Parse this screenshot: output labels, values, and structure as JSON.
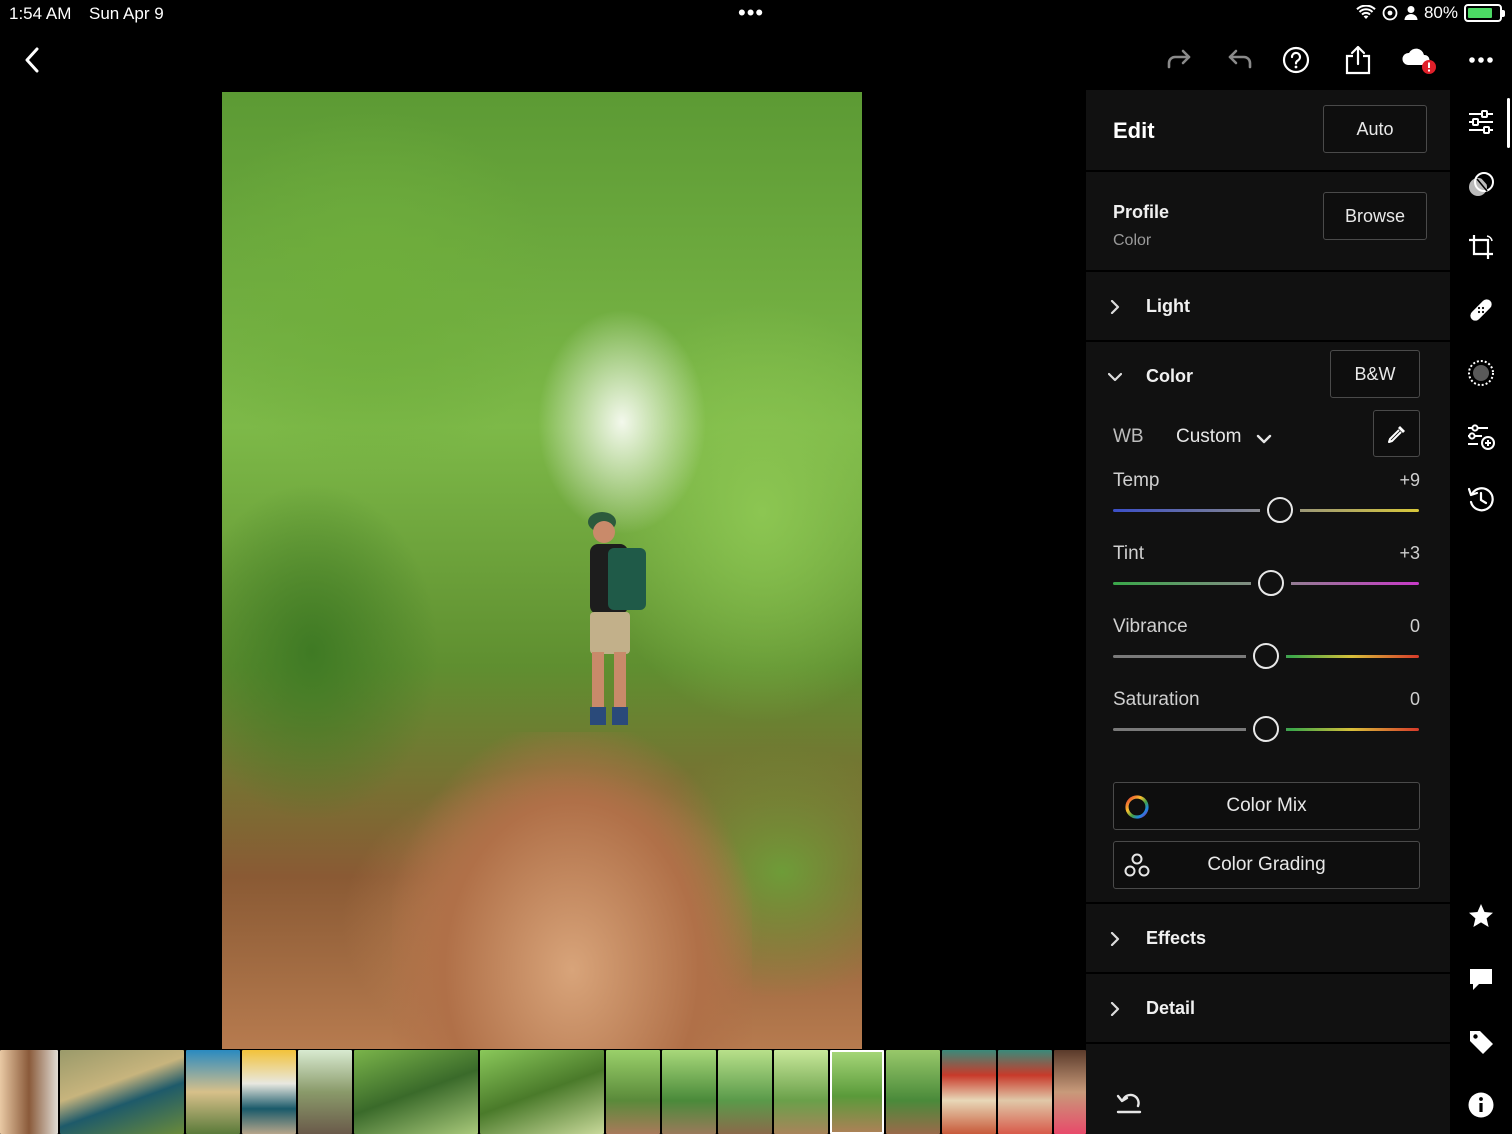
{
  "status_bar": {
    "time": "1:54 AM",
    "date": "Sun Apr 9",
    "center_dots": "•••",
    "battery_percent": "80%",
    "battery_level": 0.8
  },
  "toolbar": {
    "back_icon": "chevron-left-icon",
    "redo_icon": "redo-icon",
    "undo_icon": "undo-icon",
    "help_icon": "help-icon",
    "share_icon": "share-icon",
    "cloud_icon": "cloud-sync-error-icon",
    "cloud_badge": "!",
    "more_icon": "more-icon"
  },
  "edit_panel": {
    "title": "Edit",
    "auto_label": "Auto",
    "profile": {
      "label": "Profile",
      "value": "Color",
      "browse_label": "Browse"
    },
    "sections": {
      "light": "Light",
      "color": "Color",
      "effects": "Effects",
      "detail": "Detail"
    },
    "color": {
      "bw_label": "B&W",
      "wb_label": "WB",
      "wb_value": "Custom",
      "eyedropper_icon": "eyedropper-icon",
      "sliders": [
        {
          "label": "Temp",
          "value": "+9",
          "position": 0.545
        },
        {
          "label": "Tint",
          "value": "+3",
          "position": 0.515
        },
        {
          "label": "Vibrance",
          "value": "0",
          "position": 0.5
        },
        {
          "label": "Saturation",
          "value": "0",
          "position": 0.5
        }
      ],
      "color_mix_label": "Color Mix",
      "color_grading_label": "Color Grading"
    },
    "reset_icon": "reset-icon"
  },
  "rail": {
    "icons": [
      "adjust-sliders-icon",
      "masking-icon",
      "crop-icon",
      "healing-icon",
      "vignette-icon",
      "presets-icon",
      "history-icon",
      "star-icon",
      "comment-icon",
      "tag-icon",
      "info-icon"
    ]
  },
  "filmstrip": {
    "selected_index": 14
  },
  "colors": {
    "accent_white": "#ffffff",
    "panel_bg": "#111111",
    "badge_red": "#e0202a",
    "battery_green": "#4cd964"
  }
}
